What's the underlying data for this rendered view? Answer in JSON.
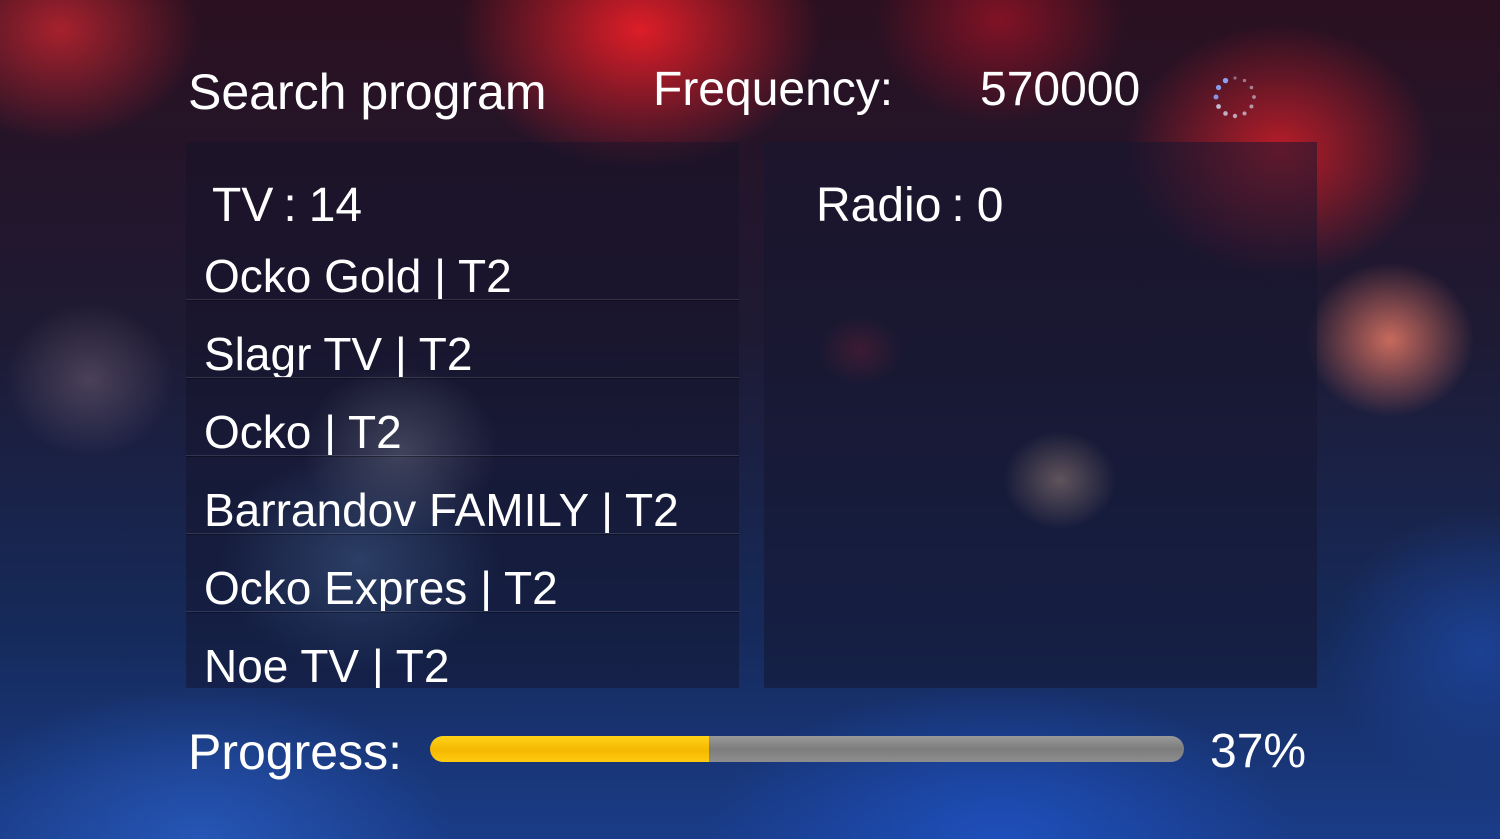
{
  "header": {
    "title": "Search program",
    "frequency_label": "Frequency:",
    "frequency_value": "570000",
    "status_icon": "loading-spinner-icon"
  },
  "tv": {
    "label": "TV",
    "separator": ":",
    "count": "14",
    "channels": [
      "Ocko Gold | T2",
      "Slagr TV | T2",
      "Ocko | T2",
      "Barrandov FAMILY | T2",
      "Ocko Expres | T2",
      "Noe TV | T2"
    ]
  },
  "radio": {
    "label": "Radio",
    "separator": ":",
    "count": "0",
    "channels": []
  },
  "progress": {
    "label": "Progress:",
    "value_text": "37%",
    "percent": 37
  },
  "colors": {
    "progress_fill": "#f5b800",
    "progress_track": "#8a8a8a",
    "text": "#ffffff"
  }
}
